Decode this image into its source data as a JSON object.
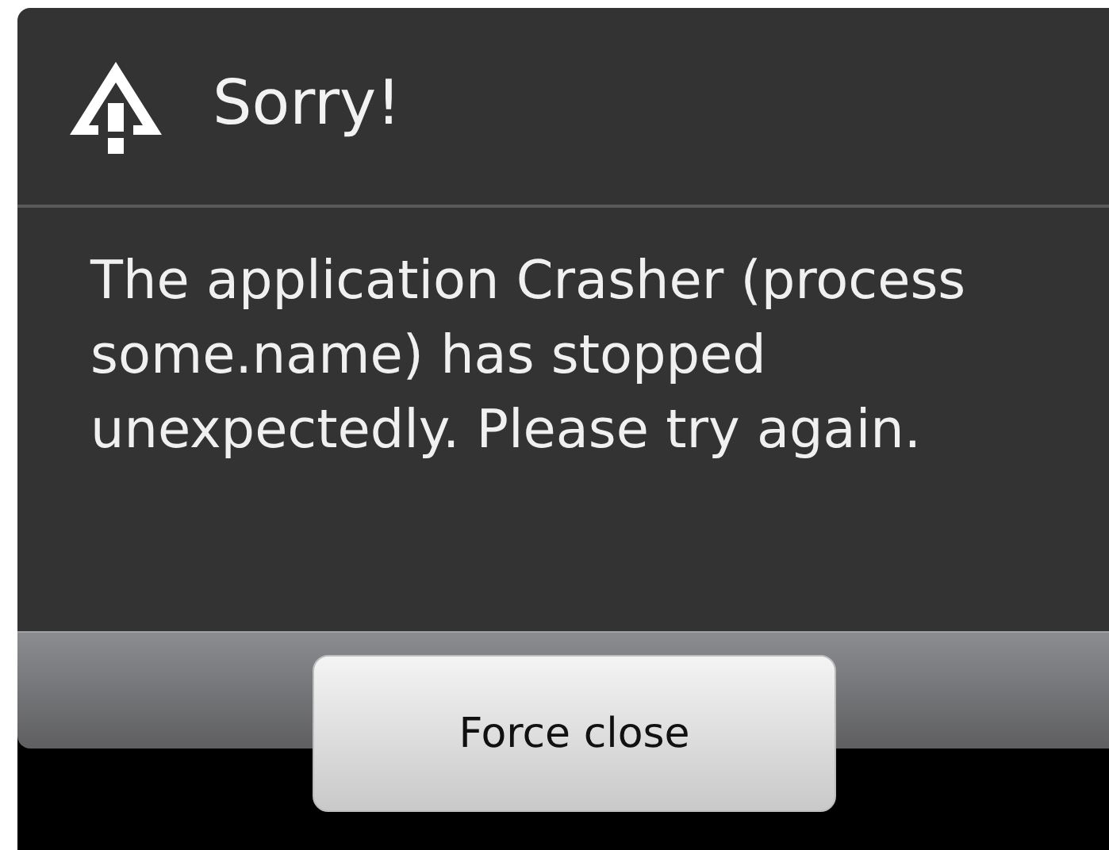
{
  "dialog": {
    "title": "Sorry!",
    "message": "The application Crasher (process some.name) has stopped unexpectedly. Please try again.",
    "buttons": [
      "Force close"
    ]
  }
}
